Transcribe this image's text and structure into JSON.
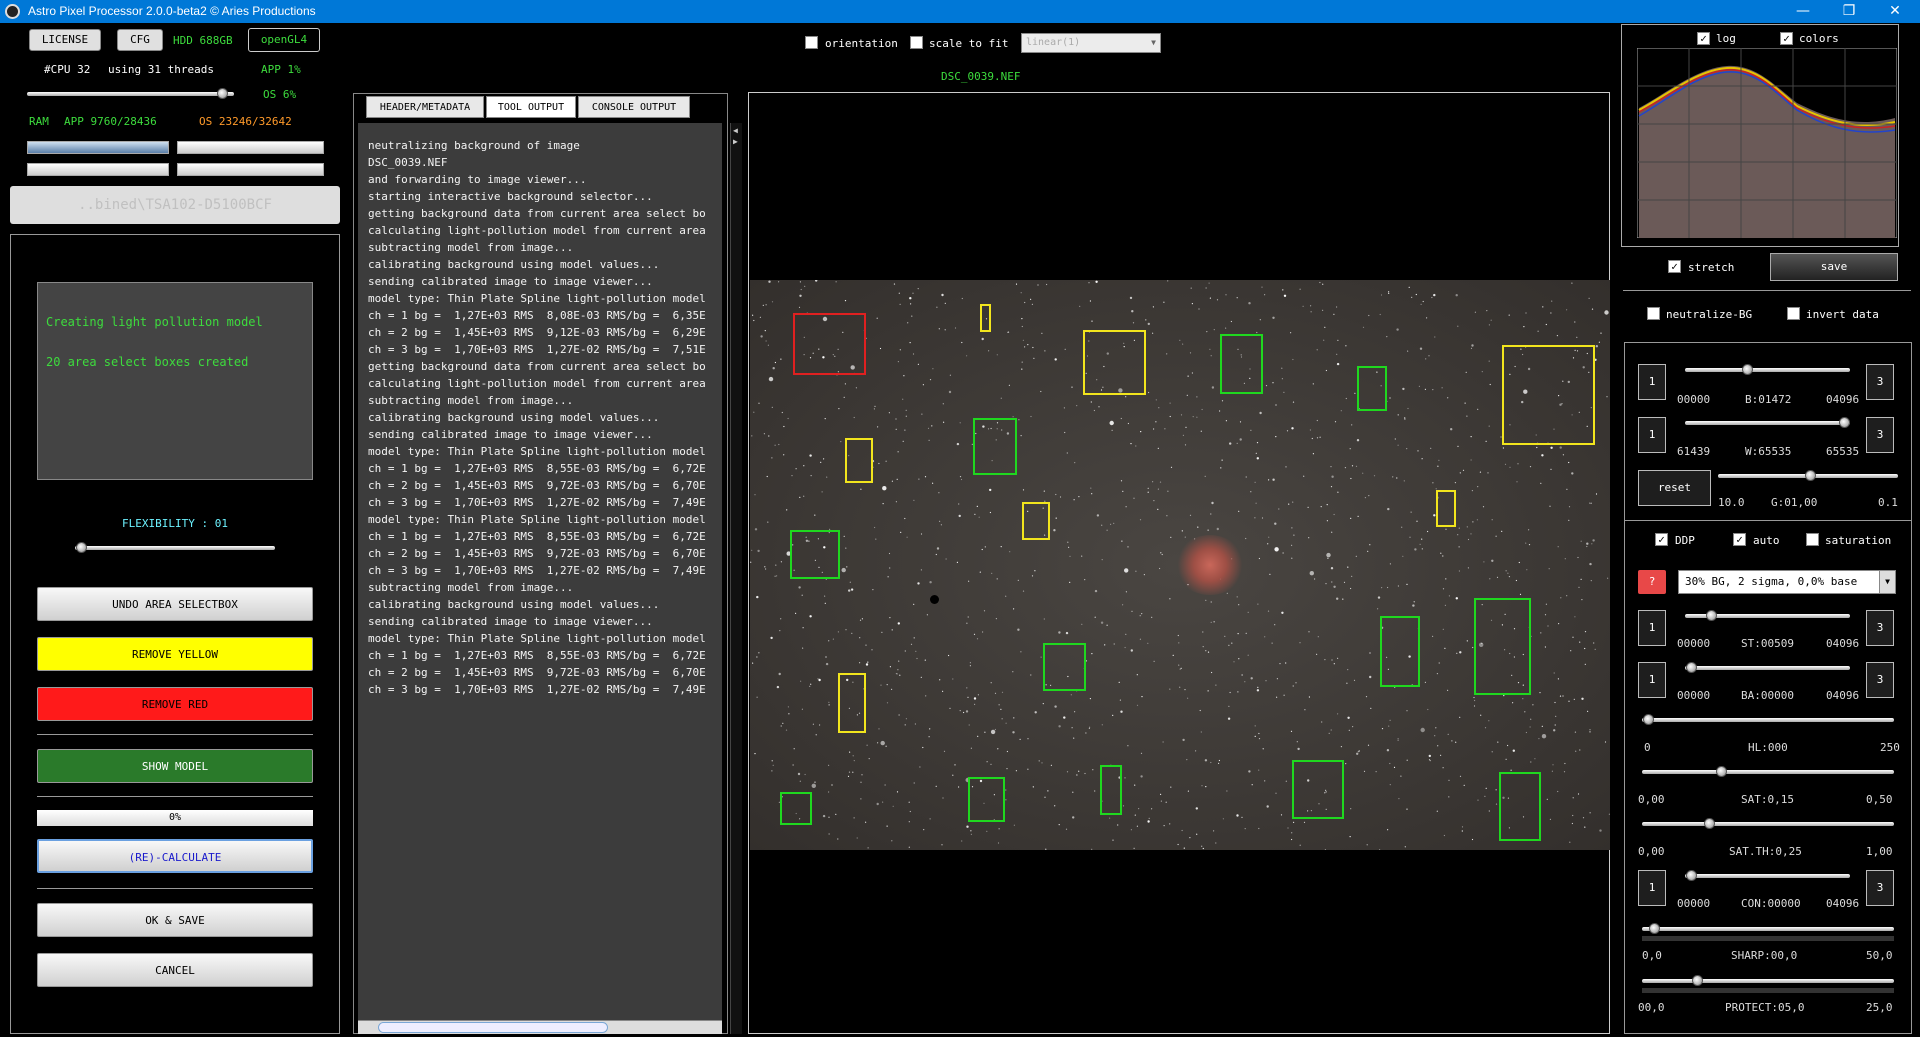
{
  "window": {
    "title": "Astro Pixel Processor 2.0.0-beta2 © Aries Productions",
    "minimize": "—",
    "maximize": "❐",
    "close": "✕"
  },
  "topleft": {
    "license": "LICENSE",
    "cfg": "CFG",
    "hdd": "HDD 688GB",
    "opengl": "openGL4",
    "cpu": "#CPU 32",
    "threads": "using 31 threads",
    "app_cpu": "APP 1%",
    "os_cpu": "OS 6%",
    "ram_label": "RAM",
    "ram_app": "APP 9760/28436",
    "ram_os": "OS 23246/32642",
    "path": "..bined\\TSA102-D5100BCF"
  },
  "tool": {
    "message_line1": "Creating light pollution model",
    "message_line2": "20 area select boxes created",
    "flexibility": "FLEXIBILITY : 01",
    "undo": "UNDO AREA SELECTBOX",
    "remove_yellow": "REMOVE YELLOW",
    "remove_red": "REMOVE RED",
    "show_model": "SHOW MODEL",
    "progress": "0%",
    "recalc": "(RE)-CALCULATE",
    "ok_save": "OK & SAVE",
    "cancel": "CANCEL"
  },
  "tabs": {
    "header": "HEADER/METADATA",
    "tool_output": "TOOL OUTPUT",
    "console_output": "CONSOLE OUTPUT"
  },
  "console": [
    "neutralizing background of image",
    "DSC_0039.NEF",
    "and forwarding to image viewer...",
    "starting interactive background selector...",
    "getting background data from current area select bo",
    "calculating light-pollution model from current area",
    "subtracting model from image...",
    "calibrating background using model values...",
    "sending calibrated image to image viewer...",
    "model type: Thin Plate Spline light-pollution model",
    "ch = 1 bg =  1,27E+03 RMS  8,08E-03 RMS/bg =  6,35E",
    "ch = 2 bg =  1,45E+03 RMS  9,12E-03 RMS/bg =  6,29E",
    "ch = 3 bg =  1,70E+03 RMS  1,27E-02 RMS/bg =  7,51E",
    "getting background data from current area select bo",
    "calculating light-pollution model from current area",
    "subtracting model from image...",
    "calibrating background using model values...",
    "sending calibrated image to image viewer...",
    "model type: Thin Plate Spline light-pollution model",
    "ch = 1 bg =  1,27E+03 RMS  8,55E-03 RMS/bg =  6,72E",
    "ch = 2 bg =  1,45E+03 RMS  9,72E-03 RMS/bg =  6,70E",
    "ch = 3 bg =  1,70E+03 RMS  1,27E-02 RMS/bg =  7,49E",
    "model type: Thin Plate Spline light-pollution model",
    "ch = 1 bg =  1,27E+03 RMS  8,55E-03 RMS/bg =  6,72E",
    "ch = 2 bg =  1,45E+03 RMS  9,72E-03 RMS/bg =  6,70E",
    "ch = 3 bg =  1,70E+03 RMS  1,27E-02 RMS/bg =  7,49E",
    "subtracting model from image...",
    "calibrating background using model values...",
    "sending calibrated image to image viewer...",
    "model type: Thin Plate Spline light-pollution model",
    "ch = 1 bg =  1,27E+03 RMS  8,55E-03 RMS/bg =  6,72E",
    "ch = 2 bg =  1,45E+03 RMS  9,72E-03 RMS/bg =  6,70E",
    "ch = 3 bg =  1,70E+03 RMS  1,27E-02 RMS/bg =  7,49E"
  ],
  "viewer": {
    "orientation": "orientation",
    "scale_to_fit": "scale to fit",
    "stretch_select": "linear(1)",
    "filename": "DSC_0039.NEF"
  },
  "right": {
    "log": "log",
    "colors": "colors",
    "stretch": "stretch",
    "save": "save",
    "neutralize_bg": "neutralize-BG",
    "invert_data": "invert data",
    "b": {
      "min": "00000",
      "label": "B:01472",
      "max": "04096"
    },
    "w": {
      "min": "61439",
      "label": "W:65535",
      "max": "65535"
    },
    "reset": "reset",
    "g": {
      "min": "10.0",
      "label": "G:01,00",
      "max": "0.1"
    },
    "ddp": "DDP",
    "auto": "auto",
    "saturation": "saturation",
    "question": "?",
    "ddp_select": "30% BG, 2 sigma, 0,0% base",
    "st": {
      "min": "00000",
      "label": "ST:00509",
      "max": "04096"
    },
    "ba": {
      "min": "00000",
      "label": "BA:00000",
      "max": "04096"
    },
    "hl": {
      "min": "0",
      "label": "HL:000",
      "max": "250"
    },
    "sat": {
      "min": "0,00",
      "label": "SAT:0,15",
      "max": "0,50"
    },
    "satth": {
      "min": "0,00",
      "label": "SAT.TH:0,25",
      "max": "1,00"
    },
    "con": {
      "min": "00000",
      "label": "CON:00000",
      "max": "04096"
    },
    "sharp": {
      "min": "0,0",
      "label": "SHARP:00,0",
      "max": "50,0"
    },
    "protect": {
      "min": "00,0",
      "label": "PROTECT:05,0",
      "max": "25,0"
    },
    "btn1": "1",
    "btn3": "3"
  }
}
